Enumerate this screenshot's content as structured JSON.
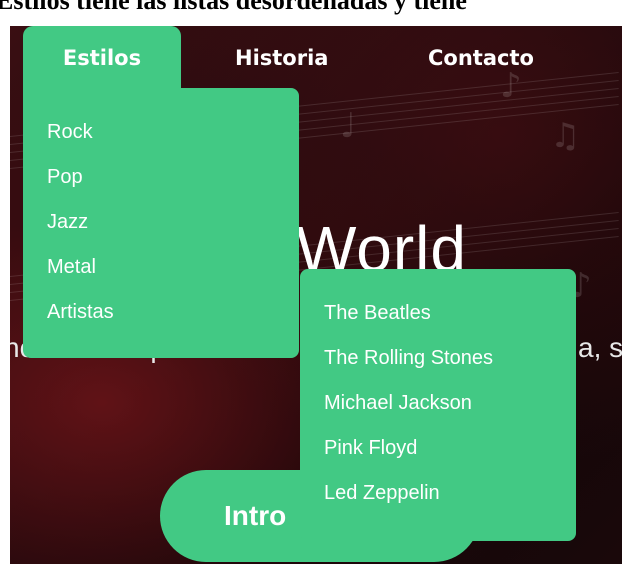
{
  "caption": "Estilos tiene las listas desordenadas y tiene",
  "nav": [
    {
      "label": "Estilos"
    },
    {
      "label": "Historia"
    },
    {
      "label": "Contacto"
    }
  ],
  "dropdown": {
    "items": [
      "Rock",
      "Pop",
      "Jazz",
      "Metal",
      "Artistas"
    ]
  },
  "submenu": {
    "items": [
      "The Beatles",
      "The Rolling Stones",
      "Michael Jackson",
      "Pink Floyd",
      "Led Zeppelin"
    ]
  },
  "hero": {
    "title": "World",
    "subtitle_left": "nocerás un poco M",
    "subtitle_right": "a, s",
    "button_label": "Intro"
  },
  "colors": {
    "accent": "#42c984",
    "background": "#1f0a0d"
  }
}
